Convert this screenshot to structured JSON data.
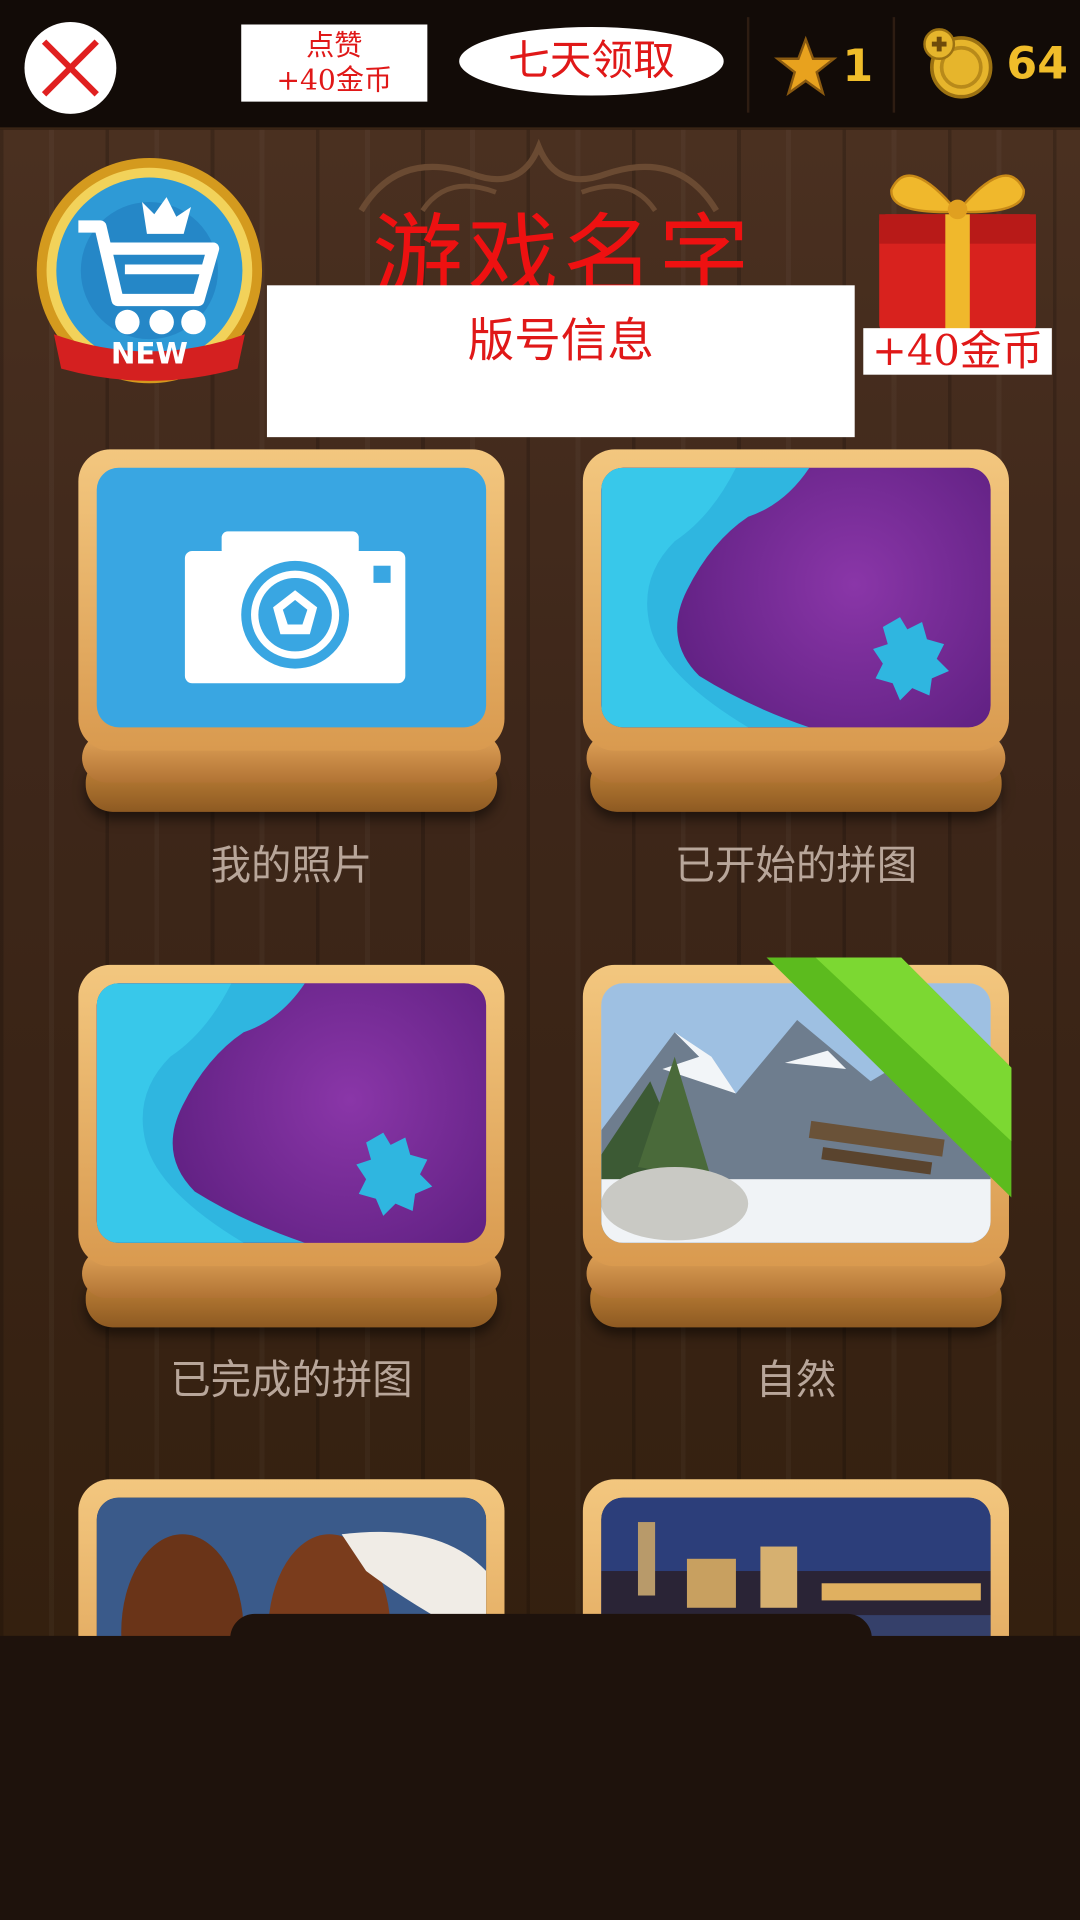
{
  "topbar": {
    "like_line1": "点赞",
    "like_line2": "+40金币",
    "seven_day": "七天领取",
    "stars": "1",
    "coins": "64"
  },
  "header": {
    "game_title": "游戏名字",
    "version_info": "版号信息",
    "cart_badge": "NEW",
    "gift_reward": "+40金币"
  },
  "tiles": [
    {
      "label": "我的照片",
      "icon": "camera-icon"
    },
    {
      "label": "已开始的拼图",
      "icon": "puzzle-icon"
    },
    {
      "label": "已完成的拼图",
      "icon": "puzzle-icon"
    },
    {
      "label": "自然",
      "icon": "landscape-image"
    },
    {
      "label": "",
      "icon": "horses-image"
    },
    {
      "label": "",
      "icon": "city-night-image"
    }
  ],
  "colors": {
    "accent_red": "#e01818",
    "gold": "#f0bd2a",
    "wood": "#3e271a",
    "label_gray": "#b8a69a"
  }
}
